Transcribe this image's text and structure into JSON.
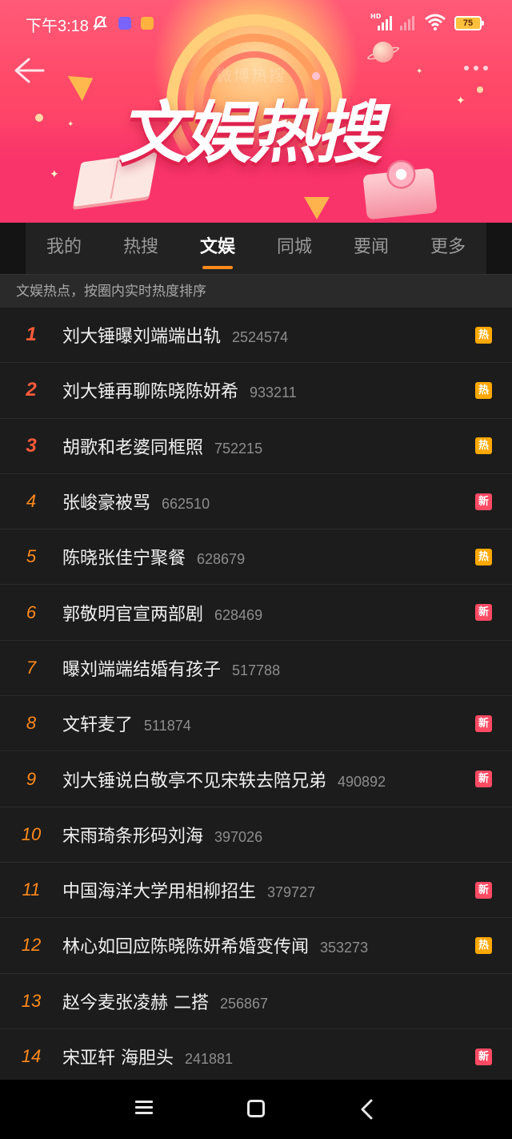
{
  "status": {
    "time": "下午3:18",
    "battery": "75",
    "network": "HD"
  },
  "header": {
    "banner_title": "文娱热搜",
    "ghost_title": "微博热搜"
  },
  "tabs": [
    {
      "label": "我的",
      "active": false
    },
    {
      "label": "热搜",
      "active": false
    },
    {
      "label": "文娱",
      "active": true
    },
    {
      "label": "同城",
      "active": false
    },
    {
      "label": "要闻",
      "active": false
    },
    {
      "label": "更多",
      "active": false
    }
  ],
  "subtitle": "文娱热点，按圈内实时热度排序",
  "badges": {
    "hot": "热",
    "new": "新"
  },
  "items": [
    {
      "rank": "1",
      "title": "刘大锤曝刘端端出轨",
      "count": "2524574",
      "badge": "热"
    },
    {
      "rank": "2",
      "title": "刘大锤再聊陈晓陈妍希",
      "count": "933211",
      "badge": "热"
    },
    {
      "rank": "3",
      "title": "胡歌和老婆同框照",
      "count": "752215",
      "badge": "热"
    },
    {
      "rank": "4",
      "title": "张峻豪被骂",
      "count": "662510",
      "badge": "新"
    },
    {
      "rank": "5",
      "title": "陈晓张佳宁聚餐",
      "count": "628679",
      "badge": "热"
    },
    {
      "rank": "6",
      "title": "郭敬明官宣两部剧",
      "count": "628469",
      "badge": "新"
    },
    {
      "rank": "7",
      "title": "曝刘端端结婚有孩子",
      "count": "517788",
      "badge": ""
    },
    {
      "rank": "8",
      "title": "文轩麦了",
      "count": "511874",
      "badge": "新"
    },
    {
      "rank": "9",
      "title": "刘大锤说白敬亭不见宋轶去陪兄弟",
      "count": "490892",
      "badge": "新"
    },
    {
      "rank": "10",
      "title": "宋雨琦条形码刘海",
      "count": "397026",
      "badge": ""
    },
    {
      "rank": "11",
      "title": "中国海洋大学用相柳招生",
      "count": "379727",
      "badge": "新"
    },
    {
      "rank": "12",
      "title": "林心如回应陈晓陈妍希婚变传闻",
      "count": "353273",
      "badge": "热"
    },
    {
      "rank": "13",
      "title": "赵今麦张凌赫 二搭",
      "count": "256867",
      "badge": ""
    },
    {
      "rank": "14",
      "title": "宋亚轩 海胆头",
      "count": "241881",
      "badge": "新"
    }
  ],
  "colors": {
    "accent": "#ff8a1c",
    "top_rank": "#ff5a3a",
    "hot_badge": "#ffa800",
    "new_badge": "#ff4a63",
    "background": "#1c1c1c"
  },
  "icons": {
    "back": "arrow-left-icon",
    "more": "more-dots-icon",
    "nav_menu": "menu-icon",
    "nav_home": "home-square-icon",
    "nav_back": "chevron-left-icon"
  }
}
